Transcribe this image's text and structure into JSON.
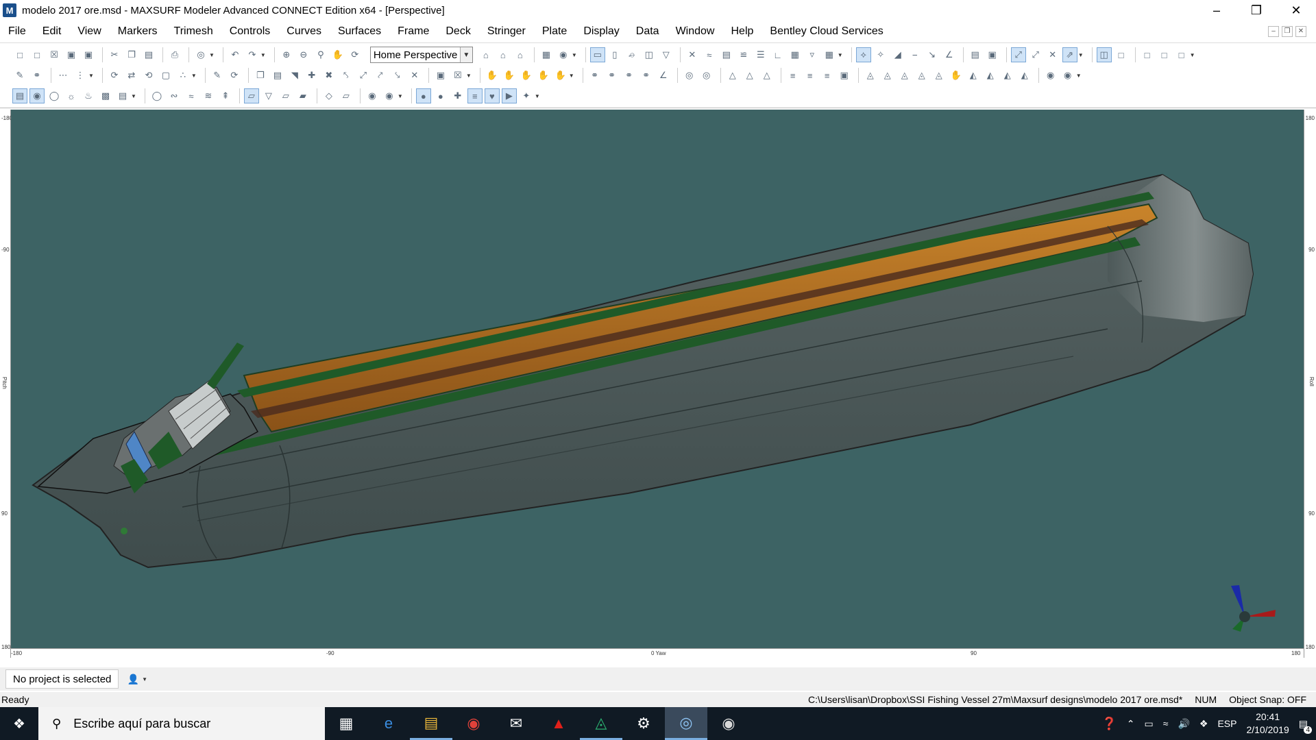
{
  "window": {
    "title": "modelo 2017 ore.msd - MAXSURF Modeler Advanced CONNECT Edition x64 - [Perspective]",
    "app_icon": "maxsurf-icon"
  },
  "menu": [
    "File",
    "Edit",
    "View",
    "Markers",
    "Trimesh",
    "Controls",
    "Curves",
    "Surfaces",
    "Frame",
    "Deck",
    "Stringer",
    "Plate",
    "Display",
    "Data",
    "Window",
    "Help",
    "Bentley Cloud Services"
  ],
  "toolbar": {
    "view_select": "Home Perspective"
  },
  "viewport": {
    "background": "#3d6364",
    "hull_color": "#4f5c5c",
    "deck_color": "#b8731f",
    "stringer_color": "#1f5a28",
    "rulers": {
      "left": [
        "-180",
        "-90",
        "Pitch",
        "90",
        "180"
      ],
      "right": [
        "180",
        "90",
        "Roll",
        "90",
        "180"
      ],
      "bottom": [
        "-180",
        "-90",
        "0 Yaw",
        "90",
        "180"
      ]
    }
  },
  "project_bar": {
    "label": "No project is selected"
  },
  "status": {
    "ready": "Ready",
    "path": "C:\\Users\\lisan\\Dropbox\\SSI Fishing Vessel 27m\\Maxsurf designs\\modelo 2017 ore.msd*",
    "num": "NUM",
    "snap": "Object Snap: OFF"
  },
  "taskbar": {
    "search_placeholder": "Escribe aquí para buscar",
    "lang": "ESP",
    "time": "20:41",
    "date": "2/10/2019",
    "notifications": "4"
  }
}
